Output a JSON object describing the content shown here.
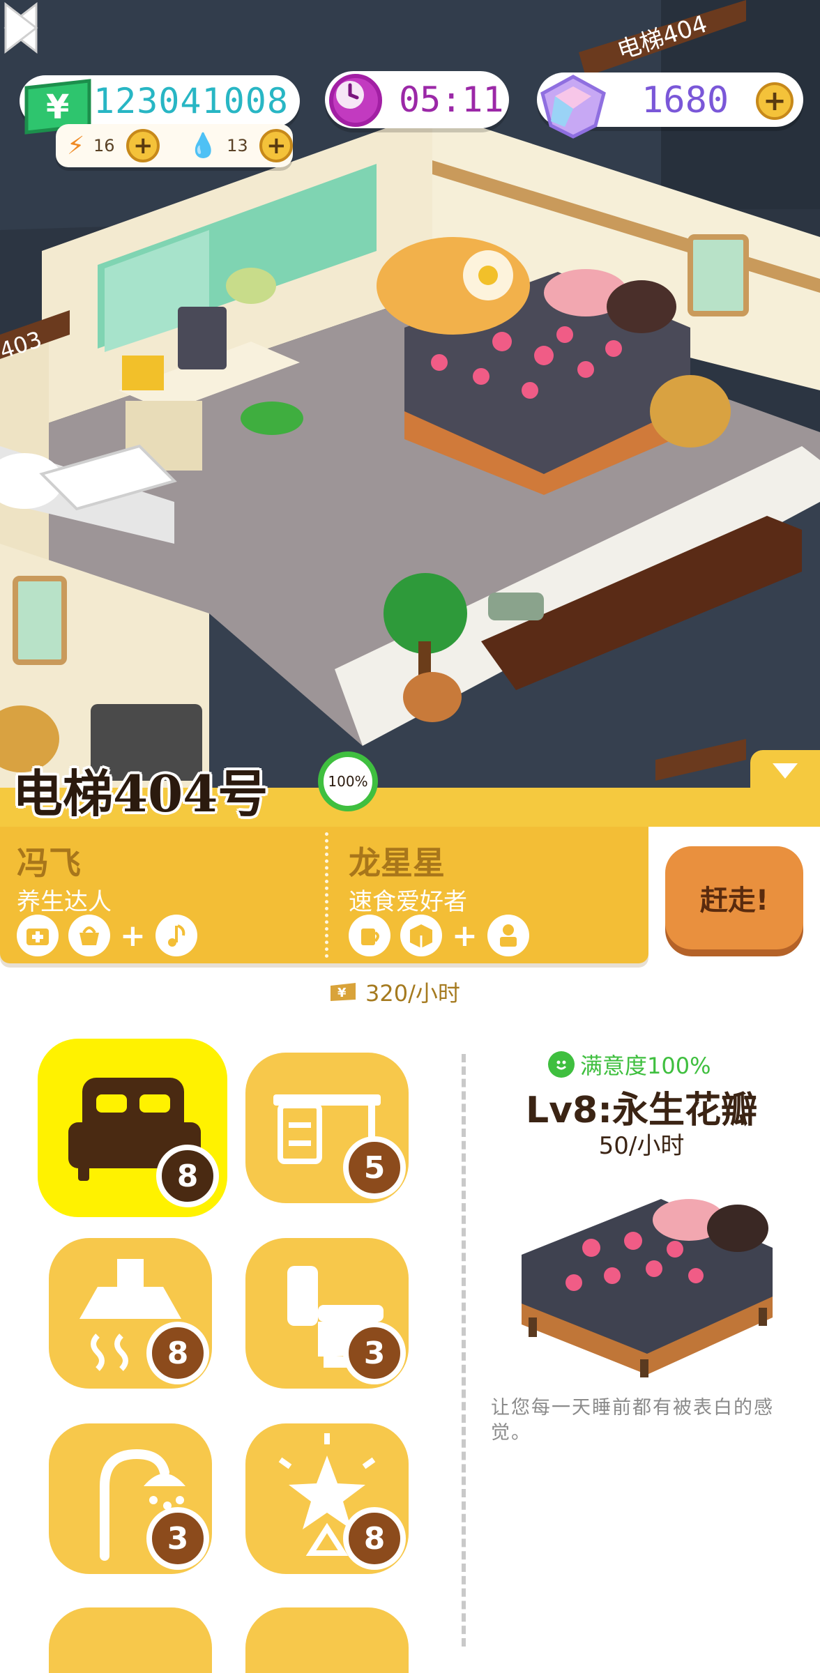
{
  "hud": {
    "money": "123041008",
    "energy": "16",
    "water": "13",
    "time": "05:11",
    "gems": "1680"
  },
  "scene": {
    "door_sign_main": "电梯404",
    "door_sign_left": "403"
  },
  "room": {
    "title": "电梯404号",
    "occupancy": "100%"
  },
  "tenants": [
    {
      "name": "冯飞",
      "title": "养生达人",
      "icons": [
        "medical-kit-icon",
        "basket-icon",
        "music-note-icon"
      ]
    },
    {
      "name": "龙星星",
      "title": "速食爱好者",
      "icons": [
        "cup-icon",
        "box-icon",
        "flower-pot-icon"
      ]
    }
  ],
  "evict_label": "赶走!",
  "rent": "320/小时",
  "categories": [
    {
      "name": "bed",
      "level": "8",
      "selected": true
    },
    {
      "name": "desk",
      "level": "5"
    },
    {
      "name": "range-hood",
      "level": "8"
    },
    {
      "name": "toilet",
      "level": "3"
    },
    {
      "name": "shower",
      "level": "3"
    },
    {
      "name": "decoration",
      "level": "8"
    }
  ],
  "detail": {
    "satisfaction": "满意度100%",
    "name": "Lv8:永生花瓣",
    "rate": "50/小时",
    "description": "让您每一天睡前都有被表白的感觉。"
  },
  "colors": {
    "accent_yellow": "#f5c93f",
    "selected_yellow": "#fff200",
    "money_cyan": "#28b6c4",
    "gem_purple": "#7a57d8",
    "evict_orange": "#e9903e",
    "satisfaction_green": "#3fbf3f"
  }
}
